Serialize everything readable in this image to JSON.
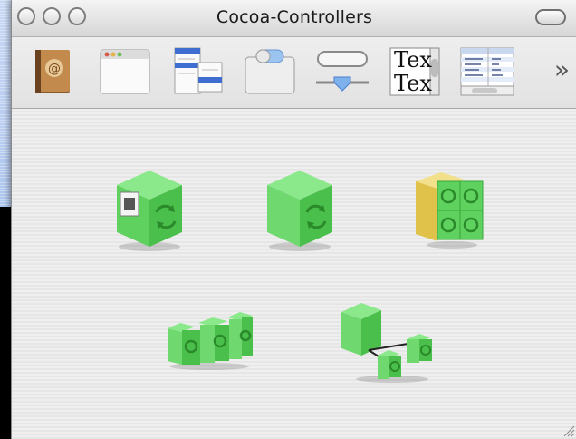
{
  "window": {
    "title": "Cocoa-Controllers"
  },
  "toolbar": {
    "items": [
      {
        "icon": "address-book-icon",
        "label": ""
      },
      {
        "icon": "window-icon",
        "label": ""
      },
      {
        "icon": "menus-icon",
        "label": ""
      },
      {
        "icon": "tab-view-icon",
        "label": ""
      },
      {
        "icon": "buttons-slider-icon",
        "label": ""
      },
      {
        "icon": "text-icon",
        "text_top": "Tex",
        "text_bottom": "Tex"
      },
      {
        "icon": "data-table-icon",
        "label": ""
      }
    ],
    "overflow_glyph": "»"
  },
  "palette": {
    "items": [
      {
        "name": "object-controller-icon"
      },
      {
        "name": "generic-controller-icon"
      },
      {
        "name": "tree-controller-icon"
      },
      {
        "name": "array-controller-icon"
      },
      {
        "name": "user-defaults-controller-icon"
      }
    ]
  },
  "colors": {
    "cube_green": "#5fd15f",
    "cube_dark": "#3aa53a",
    "titlebar": "#dcdcdc",
    "toolbar_bg": "#e8e8e8"
  }
}
